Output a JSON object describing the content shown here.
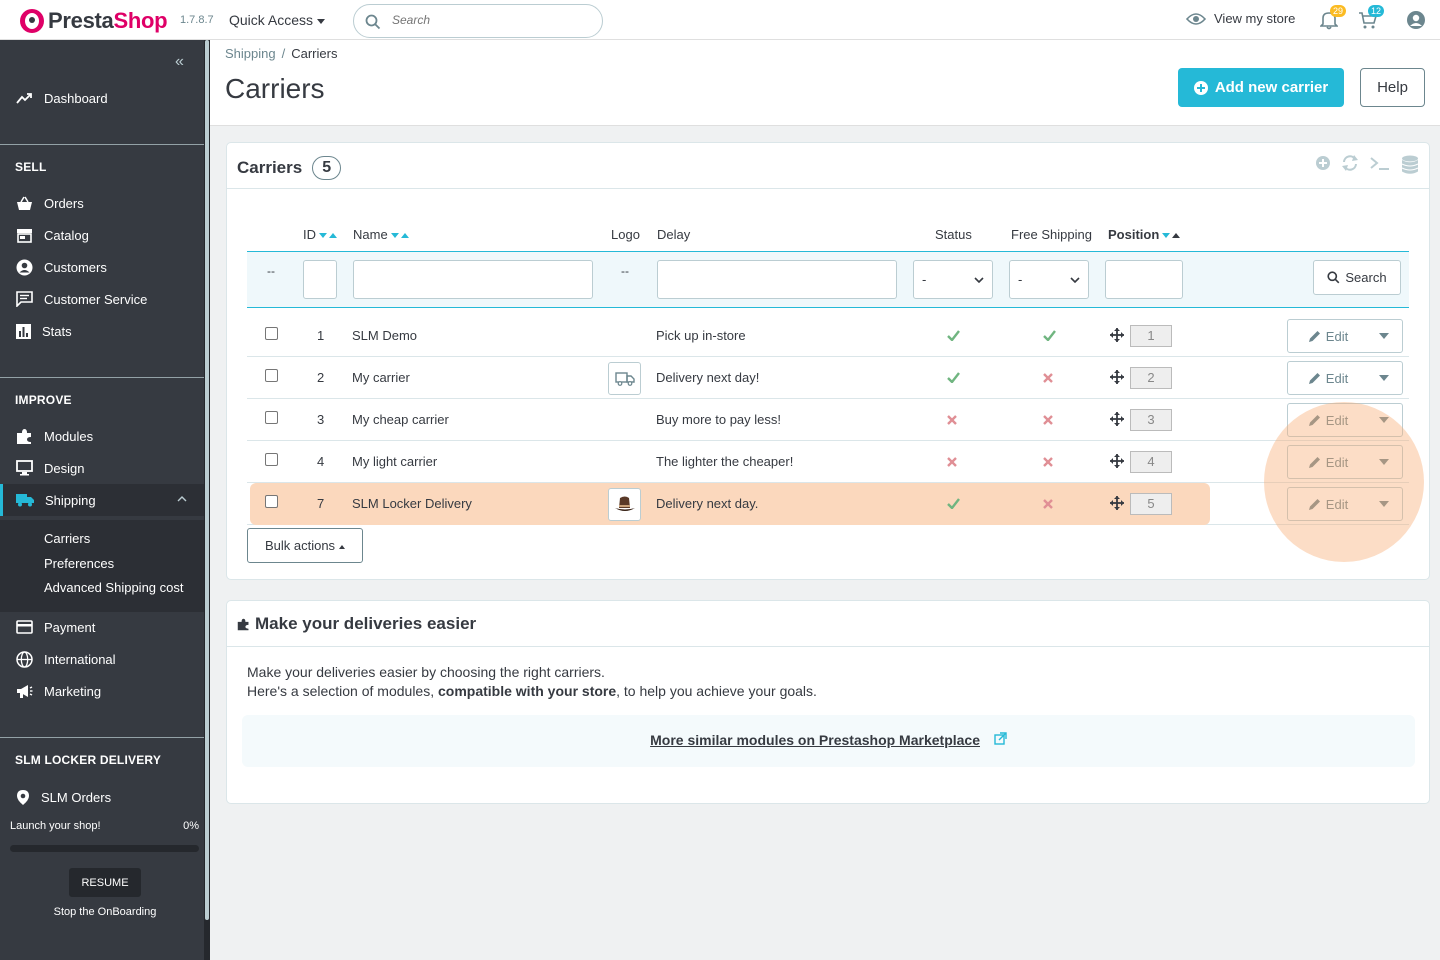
{
  "header": {
    "logo_text_1": "Presta",
    "logo_text_2": "Shop",
    "version": "1.7.8.7",
    "quick_access": "Quick Access",
    "search_placeholder": "Search",
    "view_store": "View my store",
    "notif_orders_count": "29",
    "notif_cart_count": "12"
  },
  "sidebar": {
    "dashboard": "Dashboard",
    "sell_title": "SELL",
    "orders": "Orders",
    "catalog": "Catalog",
    "customers": "Customers",
    "customer_service": "Customer Service",
    "stats": "Stats",
    "improve_title": "IMPROVE",
    "modules": "Modules",
    "design": "Design",
    "shipping": "Shipping",
    "sub_carriers": "Carriers",
    "sub_preferences": "Preferences",
    "sub_advanced": "Advanced Shipping cost",
    "payment": "Payment",
    "international": "International",
    "marketing": "Marketing",
    "slm_title": "SLM LOCKER DELIVERY",
    "slm_orders": "SLM Orders",
    "onboarding_label": "Launch your shop!",
    "onboarding_pct": "0%",
    "onboarding_progress": 0,
    "resume": "RESUME",
    "stop": "Stop the OnBoarding"
  },
  "toolbar": {
    "breadcrumb_parent": "Shipping",
    "breadcrumb_sep": "/",
    "breadcrumb_current": "Carriers",
    "title": "Carriers",
    "add_button": "Add new carrier",
    "help_button": "Help"
  },
  "carriers_panel": {
    "title": "Carriers",
    "count": "5",
    "columns": {
      "id": "ID",
      "name": "Name",
      "logo": "Logo",
      "delay": "Delay",
      "status": "Status",
      "free_shipping": "Free Shipping",
      "position": "Position"
    },
    "filter": {
      "dash1": "--",
      "dash2": "--",
      "status_value": "-",
      "free_value": "-",
      "search_button": "Search"
    },
    "rows": [
      {
        "id": "1",
        "name": "SLM Demo",
        "delay": "Pick up in-store",
        "status": true,
        "free": true,
        "position": "1",
        "logo": ""
      },
      {
        "id": "2",
        "name": "My carrier",
        "delay": "Delivery next day!",
        "status": true,
        "free": false,
        "position": "2",
        "logo": "truck-icon"
      },
      {
        "id": "3",
        "name": "My cheap carrier",
        "delay": "Buy more to pay less!",
        "status": false,
        "free": false,
        "position": "3",
        "logo": ""
      },
      {
        "id": "4",
        "name": "My light carrier",
        "delay": "The lighter the cheaper!",
        "status": false,
        "free": false,
        "position": "4",
        "logo": ""
      },
      {
        "id": "7",
        "name": "SLM Locker Delivery",
        "delay": "Delivery next day.",
        "status": true,
        "free": false,
        "position": "5",
        "logo": "hat-icon"
      }
    ],
    "edit_label": "Edit",
    "bulk_actions": "Bulk actions"
  },
  "deliveries_panel": {
    "title": "Make your deliveries easier",
    "line1": "Make your deliveries easier by choosing the right carriers.",
    "line2_a": "Here's a selection of modules, ",
    "line2_b": "compatible with your store",
    "line2_c": ", to help you achieve your goals.",
    "marketplace_link": "More similar modules on Prestashop Marketplace"
  },
  "colors": {
    "accent": "#25b9d7",
    "brand": "#df0067",
    "sidebar": "#363a41",
    "success": "#70b580",
    "danger": "#e08f95",
    "highlight": "#fbd8bd",
    "badge_orders": "#fbbb22"
  }
}
